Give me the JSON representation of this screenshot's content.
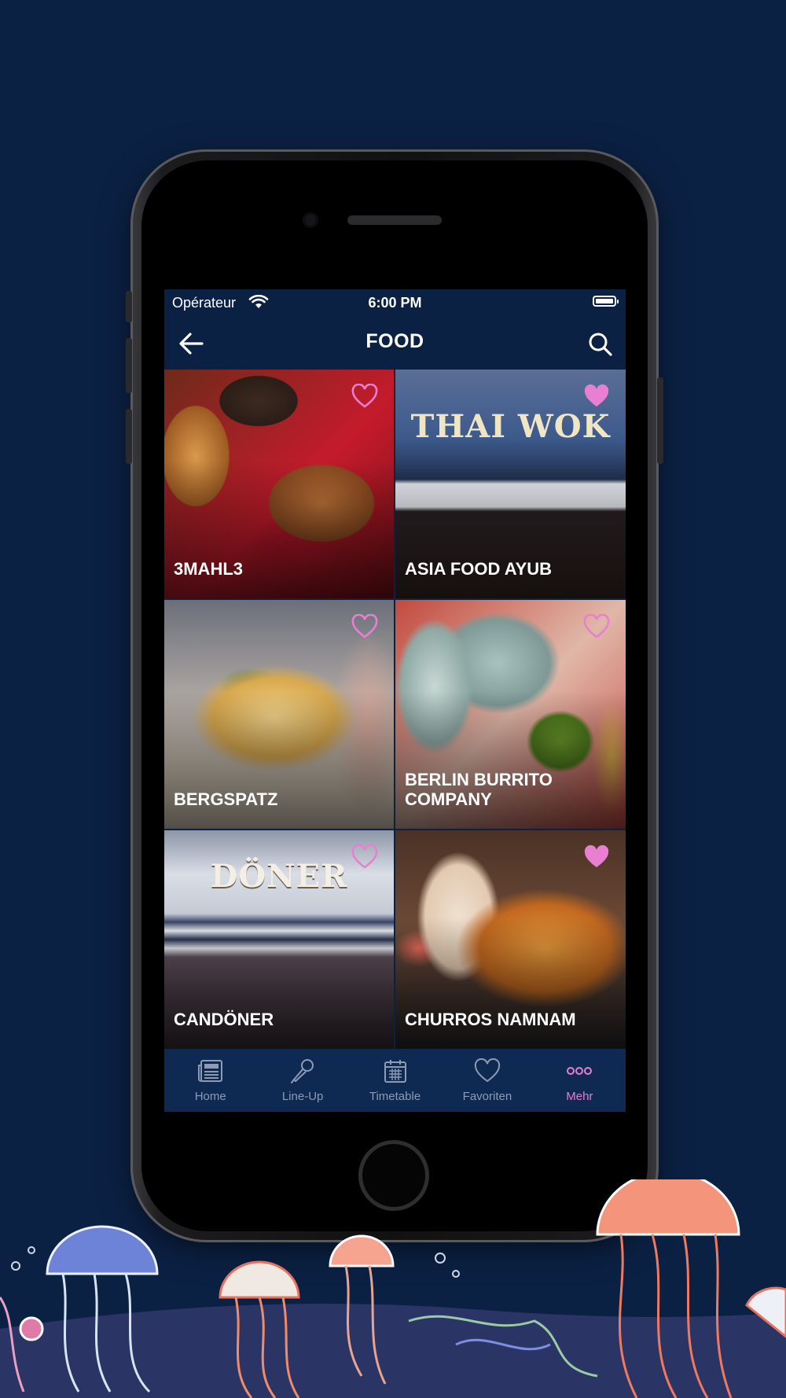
{
  "status_bar": {
    "carrier": "Opérateur",
    "time": "6:00 PM"
  },
  "header": {
    "title": "FOOD"
  },
  "vendors": [
    {
      "name": "3MAHL3",
      "favorite": false
    },
    {
      "name": "ASIA FOOD AYUB",
      "favorite": true,
      "banner": "THAI WOK"
    },
    {
      "name": "BERGSPATZ",
      "favorite": false
    },
    {
      "name": "BERLIN BURRITO COMPANY",
      "favorite": false
    },
    {
      "name": "CANDÖNER",
      "favorite": false,
      "banner": "DÖNER"
    },
    {
      "name": "CHURROS NAMNAM",
      "favorite": true
    }
  ],
  "tabbar": {
    "items": [
      {
        "label": "Home",
        "icon": "news-icon"
      },
      {
        "label": "Line-Up",
        "icon": "microphone-icon"
      },
      {
        "label": "Timetable",
        "icon": "calendar-icon"
      },
      {
        "label": "Favoriten",
        "icon": "heart-icon"
      },
      {
        "label": "Mehr",
        "icon": "more-icon",
        "active": true
      }
    ]
  },
  "colors": {
    "background": "#0b2144",
    "accent": "#e87fd0",
    "tab_inactive": "#8e9bb4"
  }
}
